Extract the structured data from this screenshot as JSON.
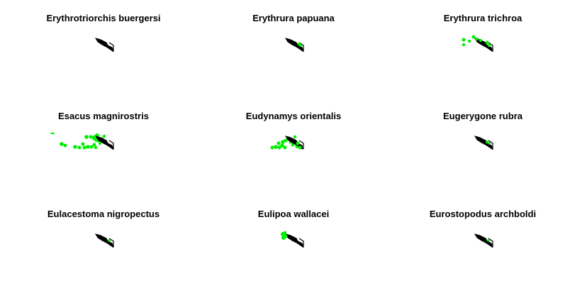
{
  "colors": {
    "occurrence": "#00ee00",
    "outline": "#000000",
    "background": "#ffffff"
  },
  "panels": [
    {
      "species": "Erythrotriorchis buergersi"
    },
    {
      "species": "Erythrura papuana"
    },
    {
      "species": "Erythrura trichroa"
    },
    {
      "species": "Esacus magnirostris"
    },
    {
      "species": "Eudynamys orientalis"
    },
    {
      "species": "Eugerygone rubra"
    },
    {
      "species": "Eulacestoma nigropectus"
    },
    {
      "species": "Eulipoa wallacei"
    },
    {
      "species": "Eurostopodus archboldi"
    }
  ]
}
